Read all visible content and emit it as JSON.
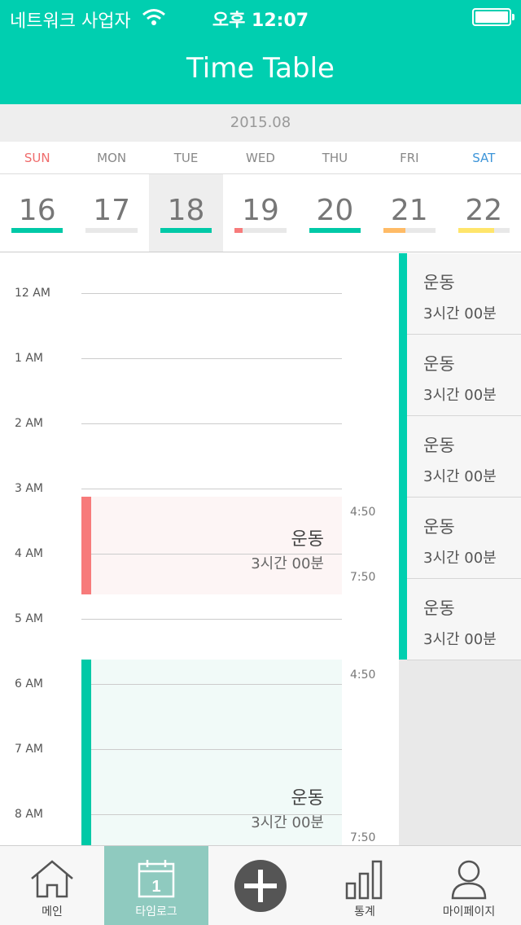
{
  "status_bar": {
    "carrier": "네트워크 사업자",
    "time": "오후 12:07"
  },
  "header": {
    "title": "Time Table"
  },
  "date": "2015.08",
  "weekdays": [
    "SUN",
    "MON",
    "TUE",
    "WED",
    "THU",
    "FRI",
    "SAT"
  ],
  "days": [
    {
      "num": "16",
      "progress": 1.0,
      "color": "#00c9a7"
    },
    {
      "num": "17",
      "progress": 0.0,
      "color": "#00c9a7"
    },
    {
      "num": "18",
      "progress": 1.0,
      "color": "#00c9a7",
      "selected": true
    },
    {
      "num": "19",
      "progress": 0.15,
      "color": "#f77b7b"
    },
    {
      "num": "20",
      "progress": 1.0,
      "color": "#00c9a7"
    },
    {
      "num": "21",
      "progress": 0.42,
      "color": "#ffbb66"
    },
    {
      "num": "22",
      "progress": 0.7,
      "color": "#ffe56b"
    }
  ],
  "timeline": {
    "hours": [
      "12 AM",
      "1 AM",
      "2 AM",
      "3 AM",
      "4 AM",
      "5 AM",
      "6 AM",
      "7 AM",
      "8 AM"
    ],
    "events": [
      {
        "title": "운동",
        "duration": "3시간 00분",
        "start_label": "4:50",
        "end_label": "7:50",
        "stripe_color": "#f77b7b",
        "bg_color": "#fdf5f5"
      },
      {
        "title": "운동",
        "duration": "3시간 00분",
        "start_label": "4:50",
        "end_label": "7:50",
        "stripe_color": "#00c9a7",
        "bg_color": "#f1faf8"
      }
    ]
  },
  "side_list": [
    {
      "title": "운동",
      "duration": "3시간 00분"
    },
    {
      "title": "운동",
      "duration": "3시간 00분"
    },
    {
      "title": "운동",
      "duration": "3시간 00분"
    },
    {
      "title": "운동",
      "duration": "3시간 00분"
    },
    {
      "title": "운동",
      "duration": "3시간 00분"
    }
  ],
  "tabbar": [
    {
      "label": "메인",
      "icon": "home-icon"
    },
    {
      "label": "타임로그",
      "icon": "calendar-icon",
      "calendar_day": "1",
      "active": true
    },
    {
      "label": "",
      "icon": "add-icon"
    },
    {
      "label": "통계",
      "icon": "stats-icon"
    },
    {
      "label": "마이페이지",
      "icon": "person-icon"
    }
  ],
  "colors": {
    "accent": "#00cfb0",
    "active_tab": "#8fcabf"
  }
}
